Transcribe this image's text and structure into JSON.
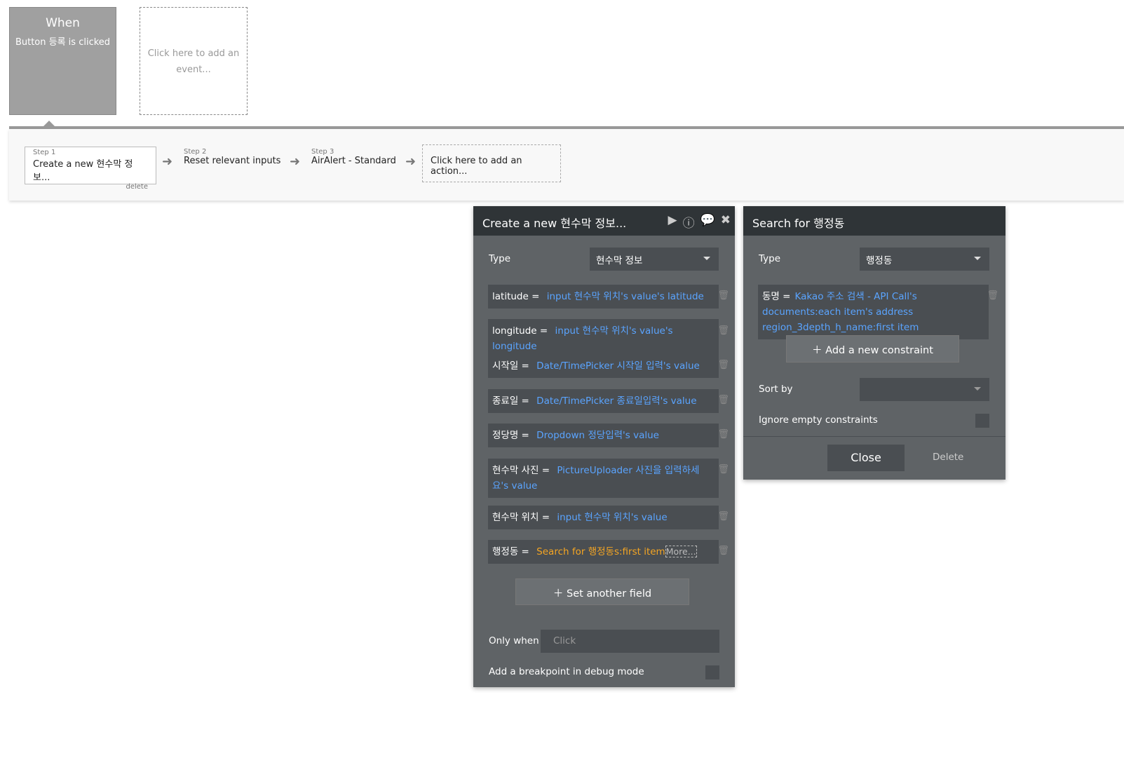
{
  "event": {
    "title": "When",
    "subtitle": "Button 등록 is clicked",
    "add_event": "Click here to add an event..."
  },
  "steps": [
    {
      "num": "Step 1",
      "label": "Create a new 현수막 정보...",
      "delete": "delete"
    },
    {
      "num": "Step 2",
      "label": "Reset relevant inputs"
    },
    {
      "num": "Step 3",
      "label": "AirAlert - Standard"
    }
  ],
  "add_action": "Click here to add an action...",
  "create_panel": {
    "title": "Create a new 현수막 정보...",
    "type_label": "Type",
    "type_value": "현수막 정보",
    "fields": [
      {
        "key": "latitude",
        "value": "input 현수막 위치's value's latitude"
      },
      {
        "key": "longitude",
        "value": "input 현수막 위치's value's longitude"
      },
      {
        "key": "시작일",
        "value": "Date/TimePicker 시작일 입력's value"
      },
      {
        "key": "종료일",
        "value": "Date/TimePicker 종료일입력's value"
      },
      {
        "key": "정당명",
        "value": "Dropdown 정당입력's value"
      },
      {
        "key": "현수막 사진",
        "value": "PictureUploader 사진을 입력하세요's value"
      },
      {
        "key": "현수막 위치",
        "value": "input 현수막 위치's value"
      },
      {
        "key": "행정동",
        "value": "Search for 행정동s:first item",
        "more": "More..."
      }
    ],
    "set_another": "Set another field",
    "only_when": "Only when",
    "only_when_placeholder": "Click",
    "breakpoint": "Add a breakpoint in debug mode"
  },
  "search_panel": {
    "title": "Search for 행정동",
    "type_label": "Type",
    "type_value": "행정동",
    "constraint_key": "동명 =",
    "constraint_value": "Kakao 주소 검색 - API Call's documents:each item's address region_3depth_h_name:first item",
    "add_constraint": "Add a new constraint",
    "sort_by": "Sort by",
    "ignore_empty": "Ignore empty constraints",
    "close": "Close",
    "delete": "Delete"
  }
}
